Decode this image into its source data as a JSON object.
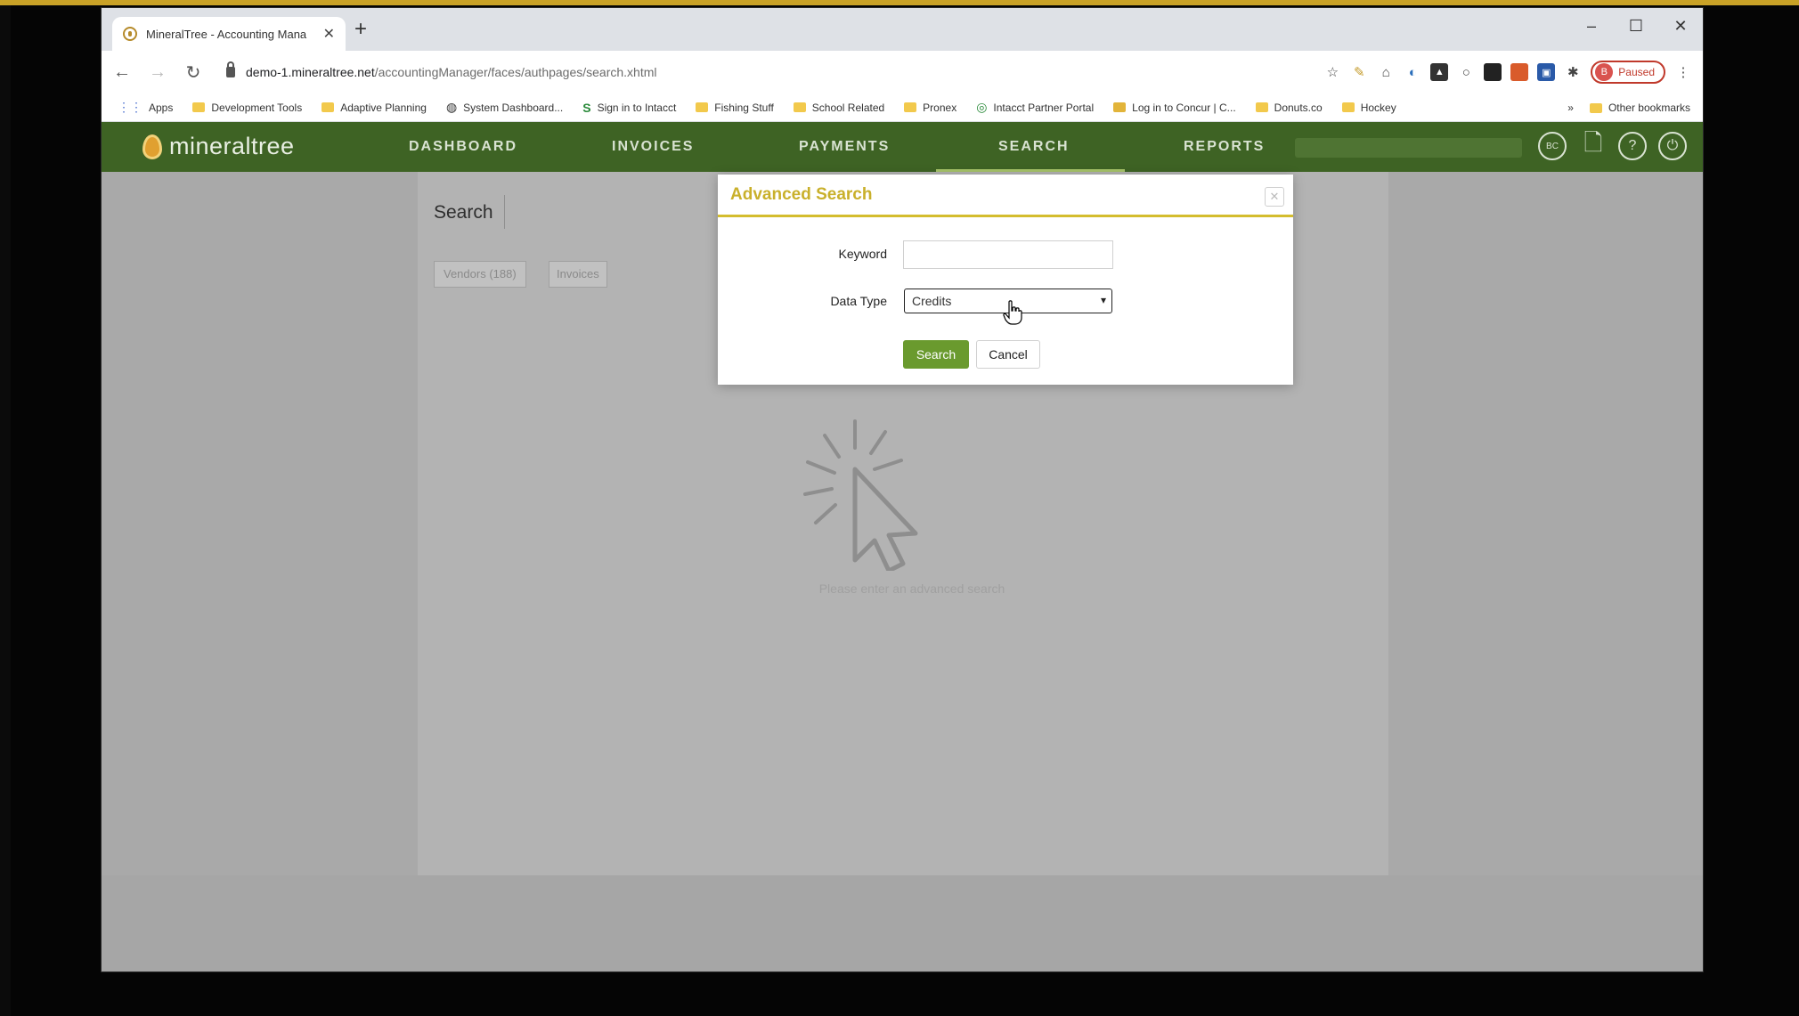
{
  "browser": {
    "tab_title": "MineralTree - Accounting Mana",
    "tab_close": "✕",
    "new_tab": "+",
    "window_controls": [
      "–",
      "☐",
      "✕"
    ],
    "url_host": "demo-1.mineraltree.net",
    "url_path": "/accountingManager/faces/authpages/search.xhtml",
    "profile_initial": "B",
    "profile_status": "Paused",
    "bookmarks": [
      {
        "label": "Apps",
        "icon": "apps-grid-icon"
      },
      {
        "label": "Development Tools",
        "icon": "folder-icon"
      },
      {
        "label": "Adaptive Planning",
        "icon": "folder-icon"
      },
      {
        "label": "System Dashboard...",
        "icon": "globe-icon"
      },
      {
        "label": "Sign in to Intacct",
        "icon": "s-icon"
      },
      {
        "label": "Fishing Stuff",
        "icon": "folder-icon"
      },
      {
        "label": "School Related",
        "icon": "folder-icon"
      },
      {
        "label": "Pronex",
        "icon": "folder-icon"
      },
      {
        "label": "Intacct Partner Portal",
        "icon": "intacct-icon"
      },
      {
        "label": "Log in to Concur | C...",
        "icon": "concur-icon"
      },
      {
        "label": "Donuts.co",
        "icon": "folder-icon"
      },
      {
        "label": "Hockey",
        "icon": "folder-icon"
      }
    ],
    "bookmarks_overflow": "»",
    "other_bookmarks": "Other bookmarks"
  },
  "app": {
    "logo_text": "mineraltree",
    "nav": [
      "DASHBOARD",
      "INVOICES",
      "PAYMENTS",
      "SEARCH",
      "REPORTS"
    ],
    "active_nav": "SEARCH",
    "header_icons": [
      "user-initials-icon",
      "document-icon",
      "help-icon",
      "logout-icon"
    ],
    "user_initials": "BC"
  },
  "page": {
    "title": "Search",
    "tabs": [
      "Vendors (188)",
      "Invoices"
    ],
    "empty_hint": "Please enter an advanced search"
  },
  "modal": {
    "title": "Advanced Search",
    "close": "✕",
    "keyword_label": "Keyword",
    "keyword_value": "",
    "data_type_label": "Data Type",
    "data_type_value": "Credits",
    "search_button": "Search",
    "cancel_button": "Cancel"
  },
  "colors": {
    "app_header": "#3e6324",
    "primary_button": "#6a9a2e",
    "modal_accent": "#d4bd2e",
    "modal_title": "#c9b02b"
  }
}
